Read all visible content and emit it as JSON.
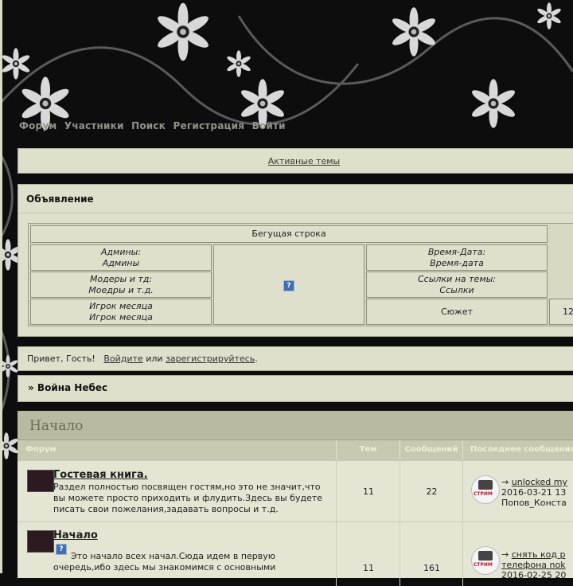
{
  "nav": [
    "Форум",
    "Участники",
    "Поиск",
    "Регистрация",
    "Войти"
  ],
  "active_topics": "Активные темы",
  "announcement": {
    "title": "Объявление",
    "marquee": "Бегущая строка",
    "cells": {
      "admins": [
        "Админы:",
        "Админы"
      ],
      "mods": [
        "Модеры и тд:",
        "Моедры и т.д."
      ],
      "player": [
        "Игрок месяца",
        "Игрок месяца"
      ],
      "datetime": [
        "Время-Дата:",
        "Время-дата"
      ],
      "links": [
        "Ссылки на темы:",
        "Ссылки"
      ],
      "plot": "Сюжет",
      "partial": "12"
    }
  },
  "welcome": {
    "text": "Привет, Гость!",
    "login": "Войдите",
    "or": "или",
    "register": "зарегистрируйтесь",
    "dot": "."
  },
  "breadcrumb": "» Война Небес",
  "category": {
    "title": "Начало",
    "columns": [
      "Форум",
      "Тем",
      "Сообщений",
      "Последнее сообщение"
    ],
    "forums": [
      {
        "title": "Гостевая книга.",
        "desc": "Раздел полностью посвящен гостям,но это не значит,что вы можете просто приходить и флудить.Здесь вы будете писать свои пожелания,задавать вопросы и т.д.",
        "topics": "11",
        "posts": "22",
        "last_link": "unlocked my",
        "last_date": "2016-03-21 13",
        "last_user": "Попов_Конста"
      },
      {
        "title": "Начало",
        "desc": "Это начало всех начал.Сюда идем в первую очередь,ибо здесь мы знакомимся с основными",
        "topics": "11",
        "posts": "161",
        "last_link": "снять код р",
        "last_link2": "телефона nok",
        "last_date": "2016-02-25 20"
      }
    ]
  },
  "avatar_label": "СТРИМ",
  "colors": {
    "panel": "#dfe0cc",
    "header": "#b8bb9f",
    "page_bg": "#0d0d0d"
  },
  "icons": [
    "question-icon",
    "forum-icon",
    "avatar-icon",
    "arrow-icon"
  ]
}
